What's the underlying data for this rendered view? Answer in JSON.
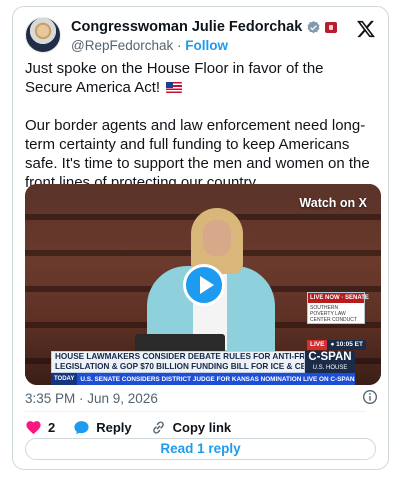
{
  "author": {
    "display_name": "Congresswoman Julie Fedorchak",
    "handle": "@RepFedorchak",
    "separator": "·",
    "follow_label": "Follow"
  },
  "tweet": {
    "paragraph1": "Just spoke on the House Floor in favor of the Secure America Act!",
    "paragraph2": "Our border agents and law enforcement need long-term certainty and full funding to keep Americans safe. It's time to support the men and women on the front lines of protecting our country."
  },
  "video": {
    "watch_label": "Watch on X",
    "live_box_top": "LIVE NOW · SENATE",
    "live_box_sub": "SOUTHERN POVERTY LAW CENTER CONDUCT",
    "live_tag": "LIVE",
    "live_time": "● 10:05 ET",
    "chyron_line1": "HOUSE LAWMAKERS CONSIDER DEBATE RULES FOR ANTI-FRAUD",
    "chyron_line2": "LEGISLATION & GOP $70 BILLION FUNDING BILL FOR ICE & CBP",
    "network_logo": "C-SPAN",
    "network_sub": "U.S. HOUSE",
    "ticker_label": "TODAY",
    "ticker_text": "U.S. SENATE CONSIDERS DISTRICT JUDGE FOR KANSAS NOMINATION  LIVE ON C-SPAN2"
  },
  "meta": {
    "timestamp": "3:35 PM · Jun 9, 2026"
  },
  "actions": {
    "likes": "2",
    "reply_label": "Reply",
    "copy_label": "Copy link",
    "read_replies_label": "Read 1 reply"
  },
  "colors": {
    "accent": "#1d9bf0",
    "like": "#f91880",
    "text": "#0f1419",
    "secondary": "#536471"
  },
  "icons": [
    "verified-badge-icon",
    "x-logo-icon",
    "play-icon",
    "info-icon",
    "heart-icon",
    "reply-bubble-icon",
    "link-icon",
    "us-flag-emoji-icon"
  ]
}
